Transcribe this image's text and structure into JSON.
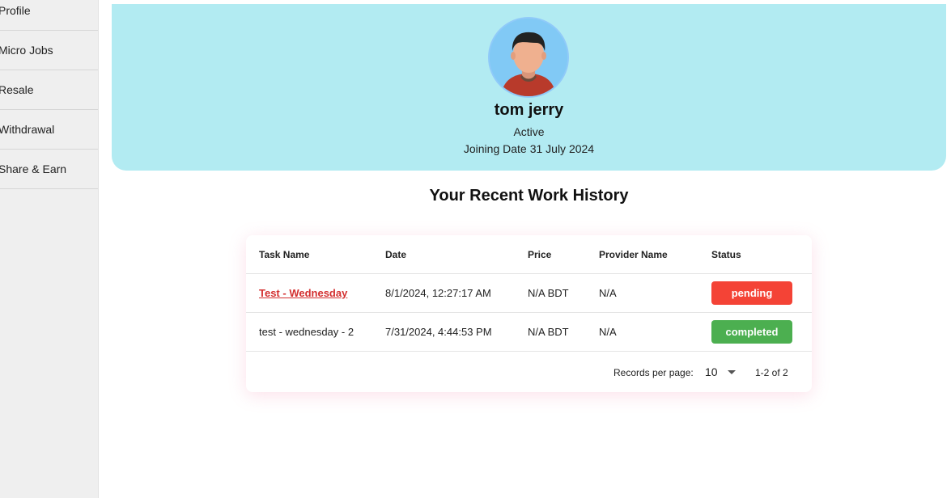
{
  "sidebar": {
    "items": [
      {
        "label": "Profile"
      },
      {
        "label": "Micro Jobs"
      },
      {
        "label": "Resale"
      },
      {
        "label": "Withdrawal"
      },
      {
        "label": "Share & Earn"
      }
    ]
  },
  "profile": {
    "name": "tom jerry",
    "status": "Active",
    "joining_label": "Joining Date",
    "joining_date": "31 July 2024"
  },
  "history": {
    "title": "Your Recent Work History",
    "columns": [
      "Task Name",
      "Date",
      "Price",
      "Provider Name",
      "Status"
    ],
    "rows": [
      {
        "task": "Test - Wednesday",
        "date": "8/1/2024, 12:27:17 AM",
        "price": "N/A BDT",
        "provider": "N/A",
        "status": "pending"
      },
      {
        "task": "test - wednesday - 2",
        "date": "7/31/2024, 4:44:53 PM",
        "price": "N/A BDT",
        "provider": "N/A",
        "status": "completed"
      }
    ],
    "records_per_page_label": "Records per page:",
    "records_per_page": "10",
    "range": "1-2 of 2"
  },
  "colors": {
    "card_bg": "#b2ebf2",
    "pending": "#f44336",
    "completed": "#4caf50",
    "link": "#d32f2f"
  }
}
